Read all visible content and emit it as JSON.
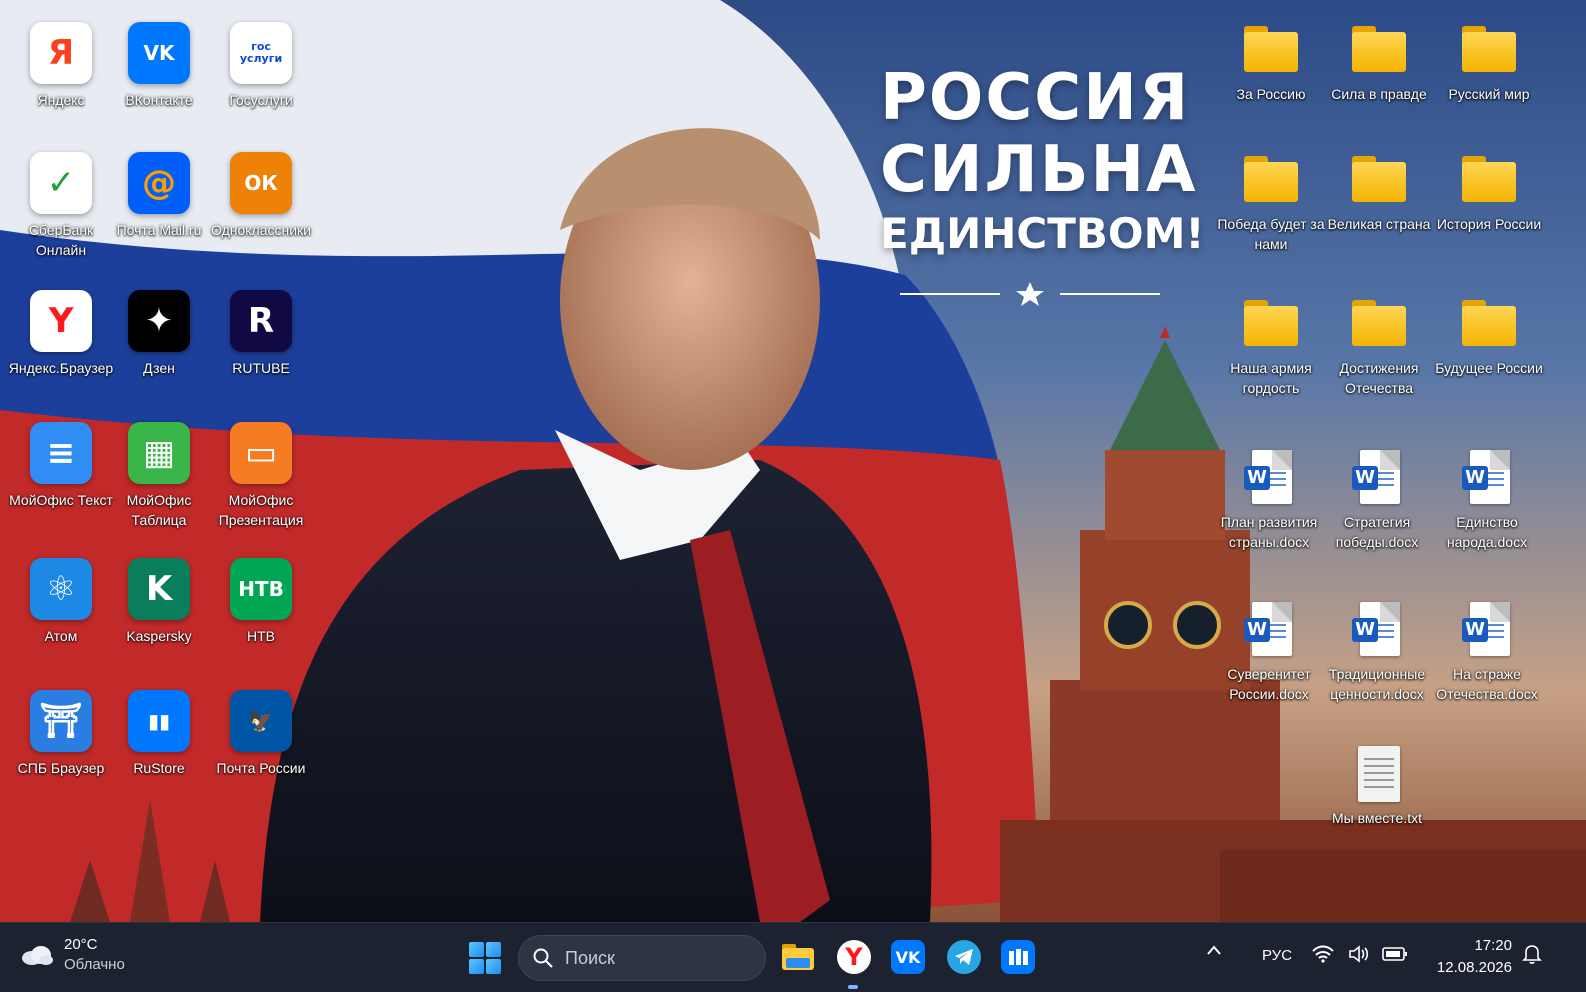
{
  "wallpaper": {
    "slogan_line1": "РОССИЯ",
    "slogan_line2": "СИЛЬНА",
    "slogan_line3": "ЕДИНСТВОМ!",
    "star_glyph": "★"
  },
  "desktop_left": [
    {
      "label": "Яндекс",
      "glyph": "Я",
      "color": "#ffffff",
      "glyph_color": "#fc3f1d"
    },
    {
      "label": "ВКонтакте",
      "glyph": "VK",
      "color": "#0077ff",
      "glyph_color": "#ffffff"
    },
    {
      "label": "Госуслуги",
      "glyph": "гос\nуслуги",
      "color": "#ffffff",
      "glyph_color": "#0d4cd3"
    },
    {
      "label": "СберБанк Онлайн",
      "glyph": "✓",
      "color": "#ffffff",
      "glyph_color": "#21a038"
    },
    {
      "label": "Почта Mail.ru",
      "glyph": "@",
      "color": "#005ff9",
      "glyph_color": "#ff9e00"
    },
    {
      "label": "Одноклассники",
      "glyph": "ОК",
      "color": "#ee8208",
      "glyph_color": "#ffffff"
    },
    {
      "label": "Яндекс.Браузер",
      "glyph": "Y",
      "color": "#ffffff",
      "glyph_color": "#ff1a1a"
    },
    {
      "label": "Дзен",
      "glyph": "✦",
      "color": "#000000",
      "glyph_color": "#ffffff"
    },
    {
      "label": "RUTUBE",
      "glyph": "R",
      "color": "#100943",
      "glyph_color": "#ffffff"
    },
    {
      "label": "МойОфис Текст",
      "glyph": "≡",
      "color": "#2f8df4",
      "glyph_color": "#ffffff"
    },
    {
      "label": "МойОфис Таблица",
      "glyph": "▦",
      "color": "#39b54a",
      "glyph_color": "#ffffff"
    },
    {
      "label": "МойОфис Презентация",
      "glyph": "▭",
      "color": "#f57c22",
      "glyph_color": "#ffffff"
    },
    {
      "label": "Атом",
      "glyph": "⚛",
      "color": "#1e88e5",
      "glyph_color": "#ffffff"
    },
    {
      "label": "Kaspersky",
      "glyph": "K",
      "color": "#0a7e5a",
      "glyph_color": "#ffffff"
    },
    {
      "label": "НТВ",
      "glyph": "НТВ",
      "color": "#00a651",
      "glyph_color": "#ffffff"
    },
    {
      "label": "СПБ Браузер",
      "glyph": "⛩",
      "color": "#2a7de1",
      "glyph_color": "#ffffff"
    },
    {
      "label": "RuStore",
      "glyph": "▮▮",
      "color": "#0077ff",
      "glyph_color": "#ffffff"
    },
    {
      "label": "Почта России",
      "glyph": "🦅",
      "color": "#0055a6",
      "glyph_color": "#ffffff"
    }
  ],
  "desktop_right_folders": [
    {
      "label": "За Россию"
    },
    {
      "label": "Сила в правде"
    },
    {
      "label": "Русский мир"
    },
    {
      "label": "Победа будет за нами"
    },
    {
      "label": "Великая страна"
    },
    {
      "label": "История России"
    },
    {
      "label": "Наша армия гордость"
    },
    {
      "label": "Достижения Отечества"
    },
    {
      "label": "Будущее России"
    }
  ],
  "desktop_right_docs": [
    {
      "label": "План развития страны.docx"
    },
    {
      "label": "Стратегия победы.docx"
    },
    {
      "label": "Единство народа.docx"
    },
    {
      "label": "Суверенитет России.docx"
    },
    {
      "label": "Традиционные ценности.docx"
    },
    {
      "label": "На страже Отечества.docx"
    }
  ],
  "desktop_right_txt": {
    "label": "Мы вместе.txt"
  },
  "taskbar": {
    "weather_temp": "20°C",
    "weather_cond": "Облачно",
    "search_placeholder": "Поиск",
    "lang": "РУС",
    "time": "17:20",
    "date": "12.08.2026",
    "apps": [
      "file-explorer",
      "yandex-browser",
      "vkontakte",
      "telegram",
      "rustore"
    ]
  }
}
